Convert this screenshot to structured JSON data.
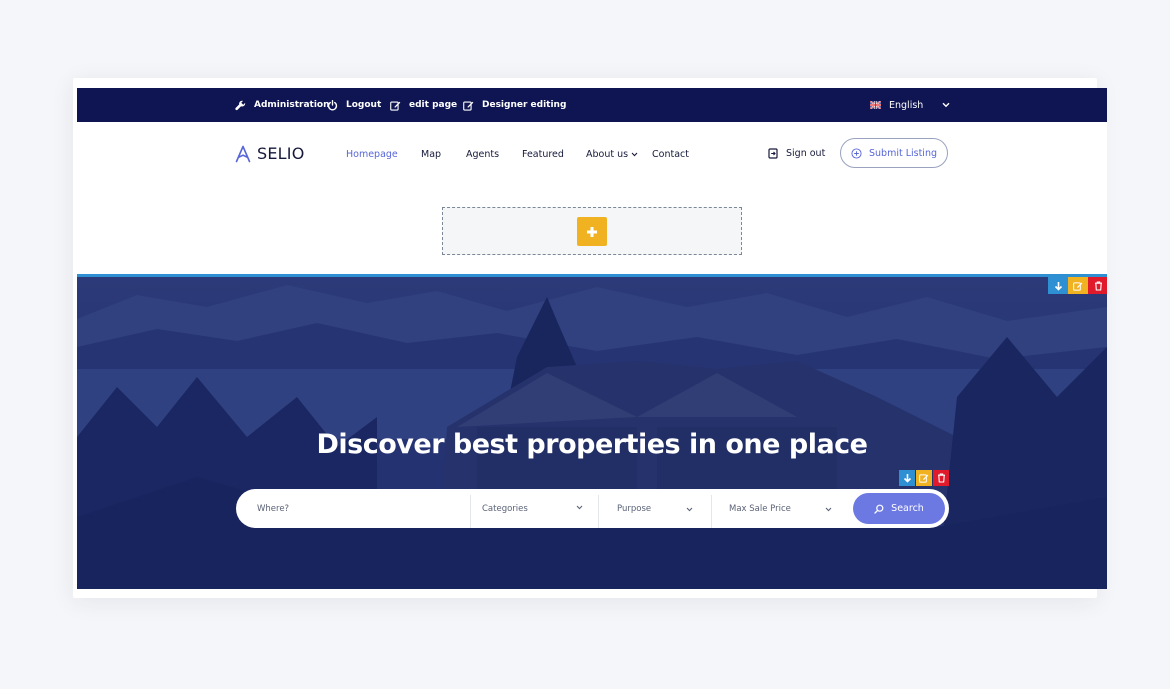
{
  "admin_bar": {
    "items": [
      {
        "label": "Administration",
        "icon": "wrench-icon"
      },
      {
        "label": "Logout",
        "icon": "power-icon"
      },
      {
        "label": "edit page",
        "icon": "edit-icon"
      },
      {
        "label": "Designer editing",
        "icon": "edit-icon"
      }
    ],
    "language": {
      "label": "English",
      "icon": "uk-flag-icon"
    }
  },
  "header": {
    "logo_text": "SELIO",
    "nav": [
      {
        "label": "Homepage",
        "active": true
      },
      {
        "label": "Map"
      },
      {
        "label": "Agents"
      },
      {
        "label": "Featured"
      },
      {
        "label": "About us",
        "has_dropdown": true
      },
      {
        "label": "Contact"
      }
    ],
    "sign_out": "Sign out",
    "submit_listing": "Submit Listing"
  },
  "hero": {
    "title": "Discover best properties in one place",
    "search": {
      "where_placeholder": "Where?",
      "categories": "Categories",
      "purpose": "Purpose",
      "max_price": "Max Sale Price",
      "button": "Search"
    }
  },
  "colors": {
    "admin_bar": "#0e1552",
    "accent": "#5766d8",
    "search_button": "#6d79e2",
    "control_blue": "#2f8fd3",
    "control_yellow": "#f1b222",
    "control_red": "#e0192b"
  }
}
